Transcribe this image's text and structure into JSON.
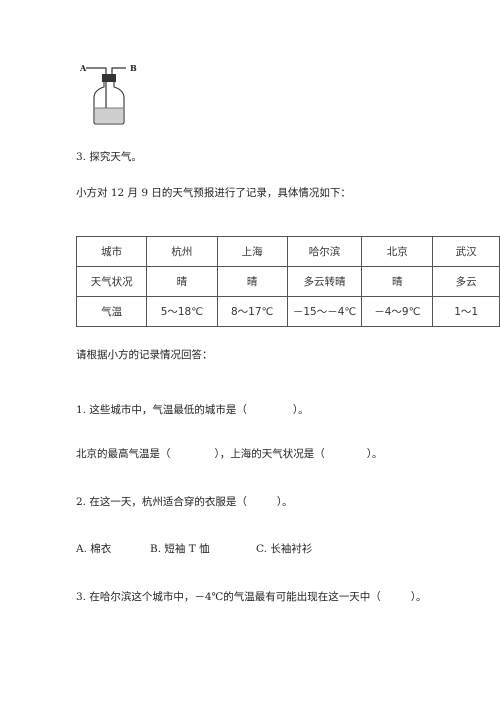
{
  "apparatus": {
    "label_a": "A",
    "label_b": "B"
  },
  "section": {
    "heading": "3. 探究天气。",
    "intro": "小方对 12 月 9 日的天气预报进行了记录，具体情况如下："
  },
  "table": {
    "rows": [
      [
        "城市",
        "杭州",
        "上海",
        "哈尔滨",
        "北京",
        "武汉"
      ],
      [
        "天气状况",
        "晴",
        "晴",
        "多云转晴",
        "晴",
        "多云"
      ],
      [
        "气温",
        "5～18℃",
        "8～17℃",
        "－15～－4℃",
        "－4～9℃",
        "1～1"
      ]
    ]
  },
  "prompt": "请根据小方的记录情况回答：",
  "questions": {
    "q1": {
      "line1_before": "1. 这些城市中，气温最低的城市是（",
      "line1_after": "）。",
      "line2_part1": "北京的最高气温是（",
      "line2_part2": "），上海的天气状况是（",
      "line2_part3": "）。"
    },
    "q2": {
      "before": "2. 在这一天，杭州适合穿的衣服是（",
      "after": "）。",
      "options": [
        "A. 棉衣",
        "B. 短袖 T 恤",
        "C. 长袖衬衫"
      ]
    },
    "q3": {
      "before": "3. 在哈尔滨这个城市中，－4℃的气温最有可能出现在这一天中（",
      "after": "）。"
    }
  }
}
